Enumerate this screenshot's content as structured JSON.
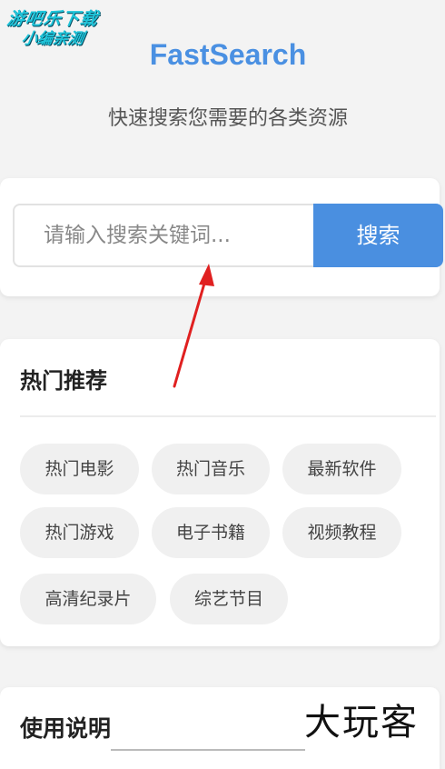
{
  "watermark_top": {
    "line1": "游吧乐下载",
    "line2": "小编亲测"
  },
  "header": {
    "title": "FastSearch",
    "subtitle": "快速搜索您需要的各类资源"
  },
  "search": {
    "placeholder": "请输入搜索关键词...",
    "button_label": "搜索"
  },
  "hot": {
    "title": "热门推荐",
    "tags": [
      "热门电影",
      "热门音乐",
      "最新软件",
      "热门游戏",
      "电子书籍",
      "视频教程",
      "高清纪录片",
      "综艺节目"
    ]
  },
  "usage": {
    "title": "使用说明"
  },
  "watermark_bottom": "大玩客",
  "colors": {
    "accent": "#4a90e2",
    "button": "#4a8fe0",
    "annotation_arrow": "#e02020"
  }
}
